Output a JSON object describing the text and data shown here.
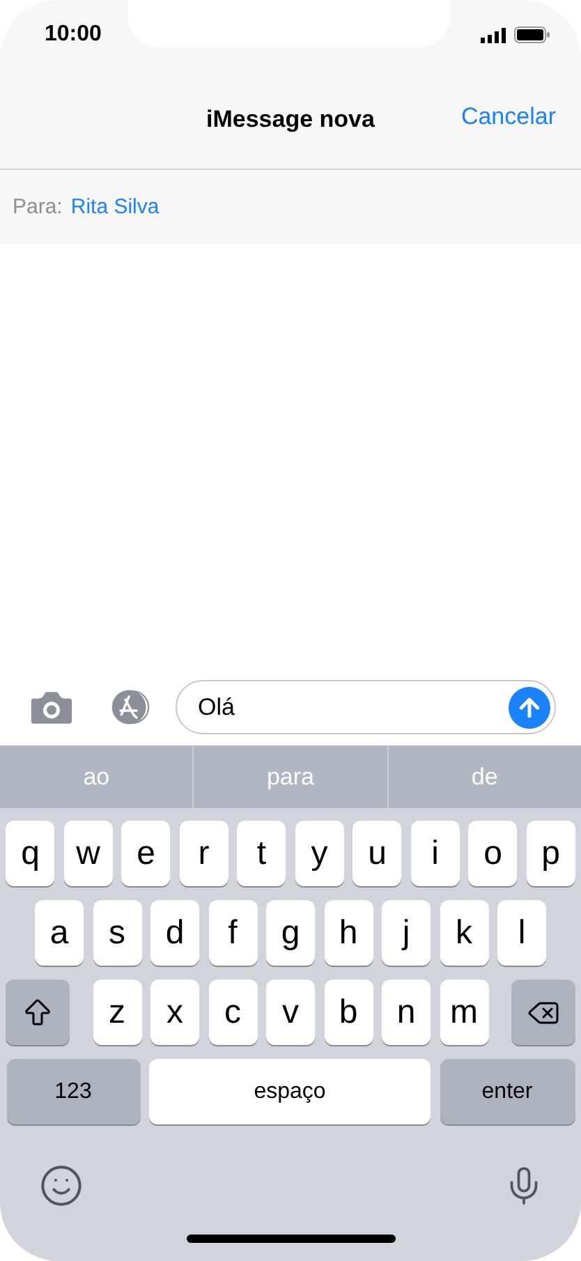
{
  "status_bar": {
    "time": "10:00"
  },
  "nav_bar": {
    "title": "iMessage nova",
    "cancel": "Cancelar"
  },
  "recipient": {
    "label": "Para:",
    "name": "Rita Silva"
  },
  "compose": {
    "value": "Olá"
  },
  "suggestions": [
    "ao",
    "para",
    "de"
  ],
  "keyboard": {
    "rows": [
      [
        "q",
        "w",
        "e",
        "r",
        "t",
        "y",
        "u",
        "i",
        "o",
        "p"
      ],
      [
        "a",
        "s",
        "d",
        "f",
        "g",
        "h",
        "j",
        "k",
        "l"
      ],
      [
        "z",
        "x",
        "c",
        "v",
        "b",
        "n",
        "m"
      ]
    ],
    "numbers": "123",
    "space": "espaço",
    "enter": "enter"
  }
}
